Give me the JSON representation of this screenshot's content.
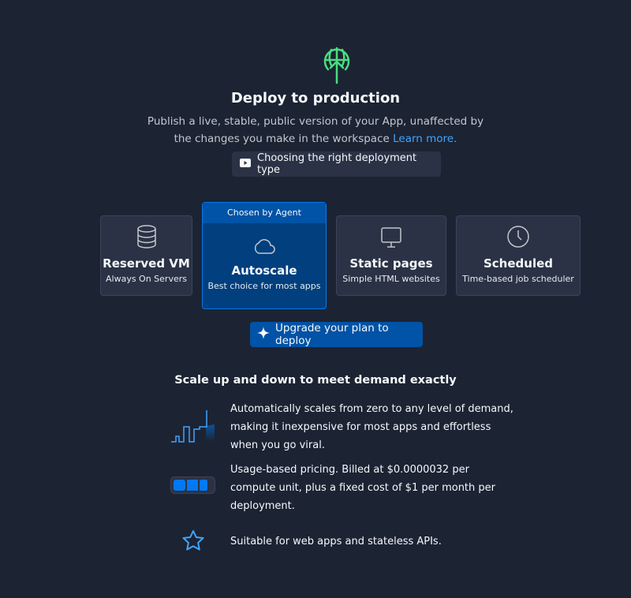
{
  "header": {
    "icon": "globe-upload-icon",
    "title": "Deploy to production",
    "subtitle_line1": "Publish a live, stable, public version of your App, unaffected by",
    "subtitle_line2": "the changes you make in the workspace",
    "learn_more": "Learn more.",
    "guide_button": "Choosing the right deployment type",
    "accent": "#4ade80"
  },
  "deployment_types": [
    {
      "name": "Reserved VM",
      "desc": "Always On Servers",
      "icon": "database-icon"
    },
    {
      "name": "Autoscale",
      "desc": "Best choice for most apps",
      "icon": "cloud-icon",
      "badge": "Chosen by Agent",
      "selected": true
    },
    {
      "name": "Static pages",
      "desc": "Simple HTML websites",
      "icon": "monitor-icon"
    },
    {
      "name": "Scheduled",
      "desc": "Time-based job scheduler",
      "icon": "clock-icon"
    }
  ],
  "upgrade_button": "Upgrade your plan to deploy",
  "details": {
    "title": "Scale up and down to meet demand exactly",
    "features": [
      {
        "icon": "scaling-graph-icon",
        "text": "Automatically scales from zero to any level of demand, making it inexpensive for most apps and effortless when you go viral."
      },
      {
        "icon": "battery-icon",
        "text": "Usage-based pricing. Billed at $0.0000032 per compute unit, plus a fixed cost of $1 per month per deployment."
      },
      {
        "icon": "star-icon",
        "text": "Suitable for web apps and stateless APIs."
      }
    ]
  }
}
